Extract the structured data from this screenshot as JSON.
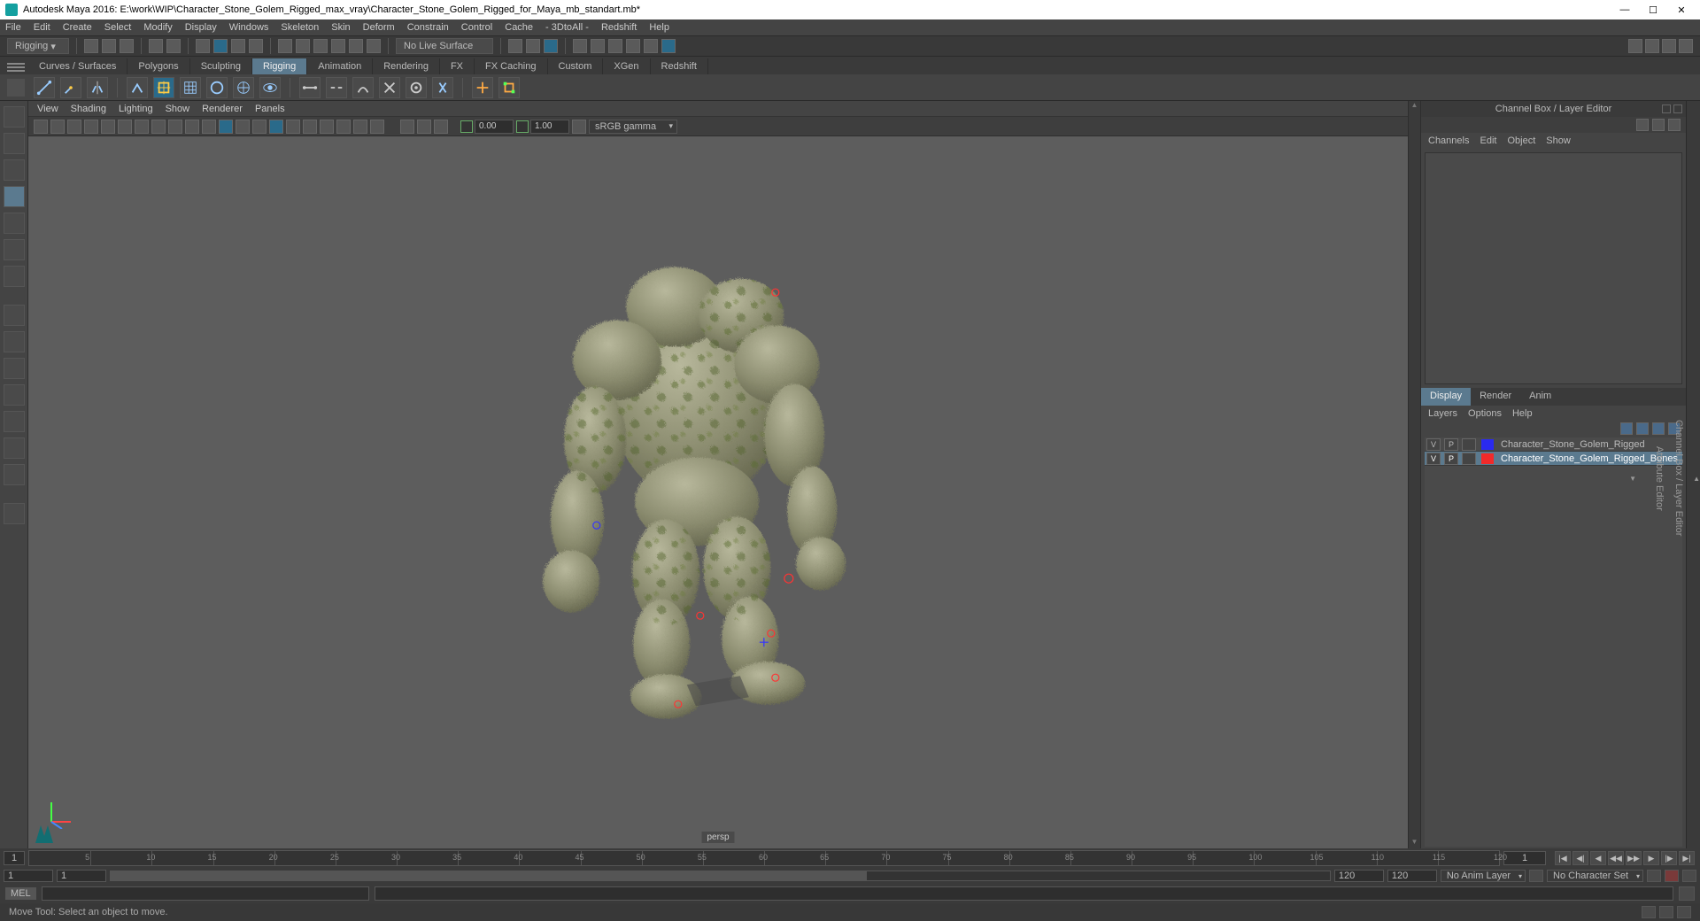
{
  "title": "Autodesk Maya 2016: E:\\work\\WIP\\Character_Stone_Golem_Rigged_max_vray\\Character_Stone_Golem_Rigged_for_Maya_mb_standart.mb*",
  "mainmenu": [
    "File",
    "Edit",
    "Create",
    "Select",
    "Modify",
    "Display",
    "Windows",
    "Skeleton",
    "Skin",
    "Deform",
    "Constrain",
    "Control",
    "Cache",
    "- 3DtoAll -",
    "Redshift",
    "Help"
  ],
  "workspace_selector": "Rigging",
  "no_live_surface": "No Live Surface",
  "shelftabs": [
    "Curves / Surfaces",
    "Polygons",
    "Sculpting",
    "Rigging",
    "Animation",
    "Rendering",
    "FX",
    "FX Caching",
    "Custom",
    "XGen",
    "Redshift"
  ],
  "active_shelftab": "Rigging",
  "viewmenu": [
    "View",
    "Shading",
    "Lighting",
    "Show",
    "Renderer",
    "Panels"
  ],
  "exposure": "0.00",
  "gamma": "1.00",
  "colorspace": "sRGB gamma",
  "persp": "persp",
  "channelbox": {
    "title": "Channel Box / Layer Editor",
    "menu": [
      "Channels",
      "Edit",
      "Object",
      "Show"
    ]
  },
  "layertabs": [
    "Display",
    "Render",
    "Anim"
  ],
  "active_layertab": "Display",
  "layermenu": [
    "Layers",
    "Options",
    "Help"
  ],
  "layers": [
    {
      "v": "V",
      "p": "P",
      "color": "#2a2af0",
      "name": "Character_Stone_Golem_Rigged",
      "sel": false
    },
    {
      "v": "V",
      "p": "P",
      "color": "#f02a2a",
      "name": "Character_Stone_Golem_Rigged_Bones",
      "sel": true
    }
  ],
  "sidetabs": [
    "Channel Box / Layer Editor",
    "Attribute Editor"
  ],
  "timeline": {
    "cur": "1",
    "end_vis": "1",
    "ticks": [
      5,
      10,
      15,
      20,
      25,
      30,
      35,
      40,
      45,
      50,
      55,
      60,
      65,
      70,
      75,
      80,
      85,
      90,
      95,
      100,
      105,
      110,
      115,
      120
    ]
  },
  "range": {
    "start": "1",
    "in": "1",
    "out": "120",
    "end": "120",
    "anim_layer": "No Anim Layer",
    "char_set": "No Character Set"
  },
  "cmd_lang": "MEL",
  "status": "Move Tool: Select an object to move."
}
